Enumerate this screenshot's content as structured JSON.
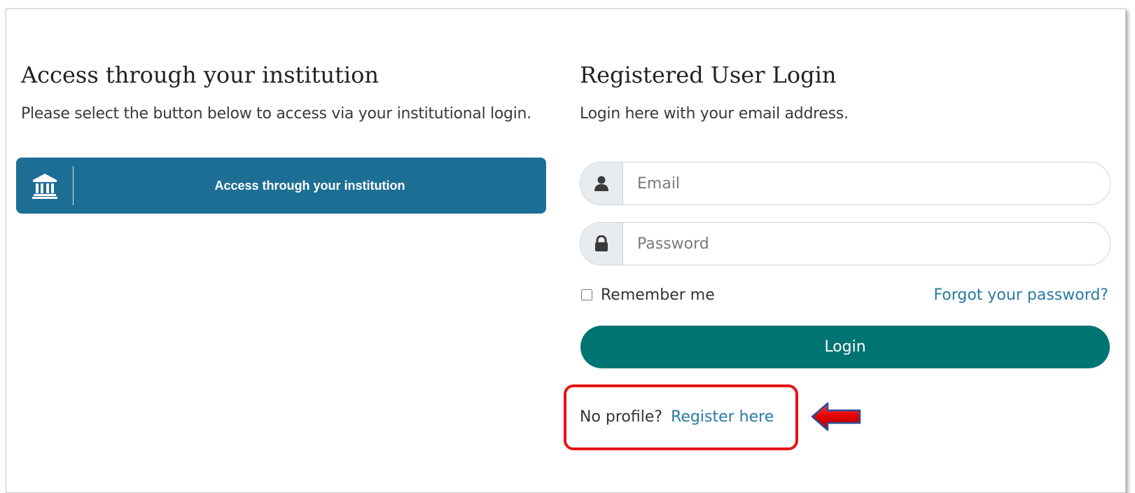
{
  "institution": {
    "title": "Access through your institution",
    "description": "Please select the button below to access via your institutional login.",
    "button_label": "Access through your institution",
    "button_icon": "institution-building-icon",
    "button_color": "#1d6e95"
  },
  "login": {
    "title": "Registered User Login",
    "description": "Login here with your email address.",
    "email_placeholder": "Email",
    "email_value": "",
    "email_icon": "user-icon",
    "password_placeholder": "Password",
    "password_value": "",
    "password_icon": "lock-icon",
    "remember_label": "Remember me",
    "remember_checked": false,
    "forgot_label": "Forgot your password?",
    "login_label": "Login",
    "login_color": "#007373"
  },
  "register": {
    "prompt": "No profile?",
    "link_label": "Register here",
    "highlight_color": "#e41414",
    "arrow_icon": "arrow-left-icon"
  }
}
